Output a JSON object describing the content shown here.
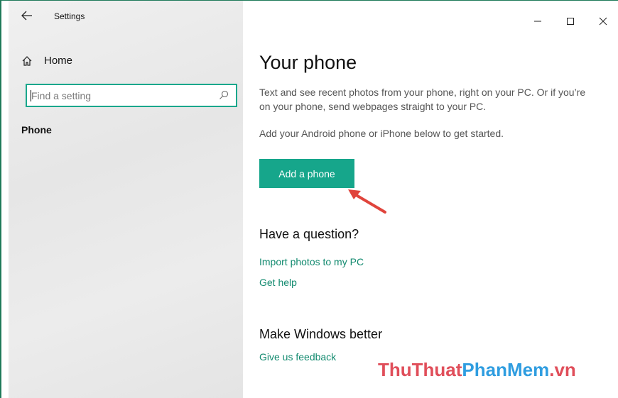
{
  "window": {
    "title": "Settings",
    "controls": {
      "minimize": "—",
      "maximize": "☐",
      "close": "✕"
    }
  },
  "sidebar": {
    "home_label": "Home",
    "search_placeholder": "Find a setting",
    "section_label": "Phone"
  },
  "main": {
    "title": "Your phone",
    "description": "Text and see recent photos from your phone, right on your PC. Or if you’re on your phone, send webpages straight to your PC.",
    "instruction": "Add your Android phone or iPhone below to get started.",
    "add_button": "Add a phone",
    "question_heading": "Have a question?",
    "links": [
      "Import photos to my PC",
      "Get help"
    ],
    "better_heading": "Make Windows better",
    "feedback_link": "Give us feedback"
  },
  "watermark": {
    "part1": "ThuThuat",
    "part2": "PhanMem",
    "part3": ".vn"
  },
  "colors": {
    "accent": "#16a68b",
    "link": "#128a6f",
    "arrow": "#e0443c"
  }
}
